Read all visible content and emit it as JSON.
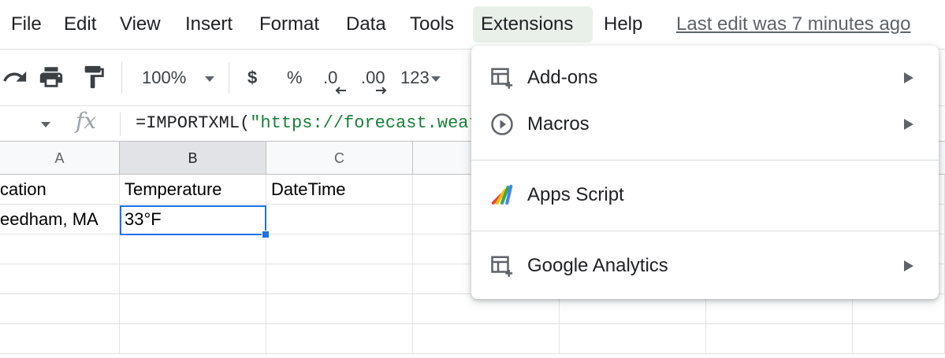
{
  "menubar": {
    "items": [
      "File",
      "Edit",
      "View",
      "Insert",
      "Format",
      "Data",
      "Tools",
      "Extensions",
      "Help"
    ],
    "last_edit": "Last edit was 7 minutes ago"
  },
  "toolbar": {
    "zoom": "100%",
    "currency": "$",
    "percent": "%",
    "decrease_decimal": ".0",
    "increase_decimal": ".00",
    "more_formats": "123"
  },
  "formula_bar": {
    "fx": "fx",
    "formula_prefix": "=IMPORTXML(",
    "formula_string": "\"https://forecast.weat"
  },
  "grid": {
    "columns": [
      "A",
      "B",
      "C"
    ],
    "rows": [
      [
        "cation",
        "Temperature",
        "DateTime"
      ],
      [
        "eedham, MA",
        "33°F",
        ""
      ]
    ]
  },
  "extensions_menu": {
    "items": [
      {
        "label": "Add-ons",
        "icon": "add-on-icon",
        "has_submenu": true
      },
      {
        "label": "Macros",
        "icon": "play-circle-icon",
        "has_submenu": true
      },
      {
        "label": "Apps Script",
        "icon": "apps-script-icon",
        "has_submenu": false
      },
      {
        "label": "Google Analytics",
        "icon": "add-on-icon",
        "has_submenu": true
      }
    ]
  },
  "colors": {
    "selection_blue": "#1a73e8",
    "active_menu_bg": "#e8f0e9",
    "formula_string_green": "#188038"
  }
}
